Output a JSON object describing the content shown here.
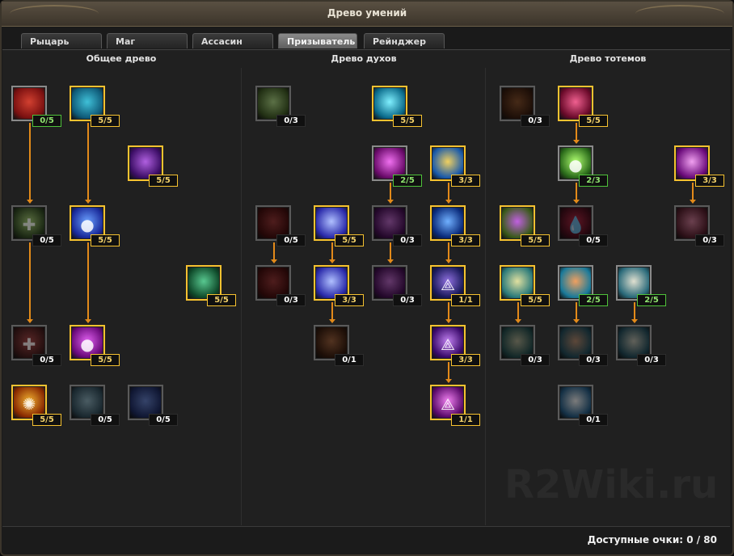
{
  "window": {
    "title": "Древо умений"
  },
  "tabs": [
    {
      "label": "Рыцарь",
      "active": false
    },
    {
      "label": "Маг",
      "active": false
    },
    {
      "label": "Ассасин",
      "active": false
    },
    {
      "label": "Призыватель",
      "active": true
    },
    {
      "label": "Рейнджер",
      "active": false
    }
  ],
  "trees": {
    "general": "Общее древо",
    "spirits": "Древо духов",
    "totems": "Древо тотемов"
  },
  "skills": [
    {
      "points": "0/5",
      "icon": "red-demon-icon",
      "badge": "green",
      "colors": [
        "#7a1010",
        "#d24030"
      ]
    },
    {
      "points": "5/5",
      "icon": "blue-spirit-icon",
      "badge": "gold",
      "colors": [
        "#0f5a78",
        "#3fc0d8"
      ]
    },
    {
      "points": "5/5",
      "icon": "purple-mage-icon",
      "badge": "gold",
      "colors": [
        "#3c0e66",
        "#b060e0"
      ]
    },
    {
      "points": "0/5",
      "icon": "green-cross-icon",
      "badge": "plain",
      "colors": [
        "#2d4a1c",
        "#9ac860"
      ]
    },
    {
      "points": "5/5",
      "icon": "blue-orbs-icon",
      "badge": "gold",
      "colors": [
        "#1a2a9a",
        "#6aa0ff"
      ]
    },
    {
      "points": "5/5",
      "icon": "green-totem-icon",
      "badge": "gold",
      "colors": [
        "#0f4a2a",
        "#58c890"
      ]
    },
    {
      "points": "0/5",
      "icon": "red-cross-icon",
      "badge": "plain",
      "colors": [
        "#4a1a1a",
        "#b04040"
      ]
    },
    {
      "points": "5/5",
      "icon": "purple-orb-icon",
      "badge": "gold",
      "colors": [
        "#6a0a7a",
        "#e060f0"
      ]
    },
    {
      "points": "5/5",
      "icon": "golden-sun-icon",
      "badge": "gold",
      "colors": [
        "#8a2a00",
        "#f0b030"
      ]
    },
    {
      "points": "0/5",
      "icon": "pale-tree-icon",
      "badge": "plain",
      "colors": [
        "#2a4a5a",
        "#80a8b8"
      ]
    },
    {
      "points": "0/5",
      "icon": "blue-tree-icon",
      "badge": "plain",
      "colors": [
        "#1a2a6a",
        "#5a7ad0"
      ]
    },
    {
      "points": "0/3",
      "icon": "green-wisp-icon",
      "badge": "plain",
      "colors": [
        "#3a5a1a",
        "#a0d070"
      ]
    },
    {
      "points": "5/5",
      "icon": "cyan-wave-icon",
      "badge": "gold",
      "colors": [
        "#0a6a8a",
        "#80f0ff"
      ]
    },
    {
      "points": "2/5",
      "icon": "pink-flame-icon",
      "badge": "green",
      "colors": [
        "#6a0a6a",
        "#f070f0"
      ]
    },
    {
      "points": "3/3",
      "icon": "yellow-blue-burst-icon",
      "badge": "gold",
      "colors": [
        "#1a5aaa",
        "#f0d060"
      ]
    },
    {
      "points": "0/5",
      "icon": "red-figure-icon",
      "badge": "plain",
      "colors": [
        "#4a0a0a",
        "#a03030"
      ]
    },
    {
      "points": "5/5",
      "icon": "blue-lightning-icon",
      "badge": "gold",
      "colors": [
        "#2a2aaa",
        "#b0c0ff"
      ]
    },
    {
      "points": "0/3",
      "icon": "purple-flame-icon",
      "badge": "plain",
      "colors": [
        "#4a0a5a",
        "#c060d0"
      ]
    },
    {
      "points": "3/3",
      "icon": "blue-figure-icon",
      "badge": "gold",
      "colors": [
        "#0a2a7a",
        "#70b0ff"
      ]
    },
    {
      "points": "0/3",
      "icon": "red-figure-icon",
      "badge": "plain",
      "colors": [
        "#4a0a0a",
        "#a03030"
      ]
    },
    {
      "points": "3/3",
      "icon": "blue-lightning-icon",
      "badge": "gold",
      "colors": [
        "#2a2aaa",
        "#b0c0ff"
      ]
    },
    {
      "points": "0/3",
      "icon": "purple-flame-icon",
      "badge": "plain",
      "colors": [
        "#4a0a5a",
        "#c060d0"
      ]
    },
    {
      "points": "1/1",
      "icon": "triad-icon",
      "badge": "gold",
      "colors": [
        "#1a1a5a",
        "#9070e0"
      ]
    },
    {
      "points": "0/1",
      "icon": "hooded-icon",
      "badge": "plain",
      "colors": [
        "#3a1a0a",
        "#a05a30"
      ]
    },
    {
      "points": "3/3",
      "icon": "triad-icon",
      "badge": "gold",
      "colors": [
        "#3a0a6a",
        "#c080f0"
      ]
    },
    {
      "points": "1/1",
      "icon": "triad-icon",
      "badge": "gold",
      "colors": [
        "#5a0a6a",
        "#f080f0"
      ]
    },
    {
      "points": "0/3",
      "icon": "dark-tree-icon",
      "badge": "plain",
      "colors": [
        "#3a1a0a",
        "#8a4a20"
      ]
    },
    {
      "points": "5/5",
      "icon": "red-hand-icon",
      "badge": "gold",
      "colors": [
        "#6a0a2a",
        "#f06090"
      ]
    },
    {
      "points": "2/3",
      "icon": "green-orb-icon",
      "badge": "green",
      "colors": [
        "#2a6a1a",
        "#b0ff70"
      ]
    },
    {
      "points": "3/3",
      "icon": "purple-skull-icon",
      "badge": "gold",
      "colors": [
        "#6a0a7a",
        "#f0a0f0"
      ]
    },
    {
      "points": "5/5",
      "icon": "green-beast-icon",
      "badge": "gold",
      "colors": [
        "#3a5a1a",
        "#c060e0"
      ]
    },
    {
      "points": "0/5",
      "icon": "blood-drop-icon",
      "badge": "plain",
      "colors": [
        "#4a0a1a",
        "#c02040"
      ]
    },
    {
      "points": "0/3",
      "icon": "pink-skull-icon",
      "badge": "plain",
      "colors": [
        "#5a1a2a",
        "#d07090"
      ]
    },
    {
      "points": "5/5",
      "icon": "horned-totem-icon",
      "badge": "gold",
      "colors": [
        "#2a7a7a",
        "#e0e0a0"
      ]
    },
    {
      "points": "2/5",
      "icon": "winged-totem-icon",
      "badge": "green",
      "colors": [
        "#1a7a9a",
        "#f0a060"
      ]
    },
    {
      "points": "2/5",
      "icon": "flame-totem-icon",
      "badge": "green",
      "colors": [
        "#2a6a7a",
        "#e0e0d0"
      ]
    },
    {
      "points": "0/3",
      "icon": "horned-totem-icon",
      "badge": "plain",
      "colors": [
        "#1a4a4a",
        "#a0a080"
      ]
    },
    {
      "points": "0/3",
      "icon": "winged-totem-icon",
      "badge": "plain",
      "colors": [
        "#1a4a5a",
        "#b08060"
      ]
    },
    {
      "points": "0/3",
      "icon": "flame-totem-icon",
      "badge": "plain",
      "colors": [
        "#1a4a5a",
        "#b0b0a0"
      ]
    },
    {
      "points": "0/1",
      "icon": "bright-totem-icon",
      "badge": "plain",
      "colors": [
        "#1a5a8a",
        "#e0e0e0"
      ]
    }
  ],
  "footer": {
    "label": "Доступные очки: 0 / 80"
  },
  "watermark": "R2Wiki.ru"
}
